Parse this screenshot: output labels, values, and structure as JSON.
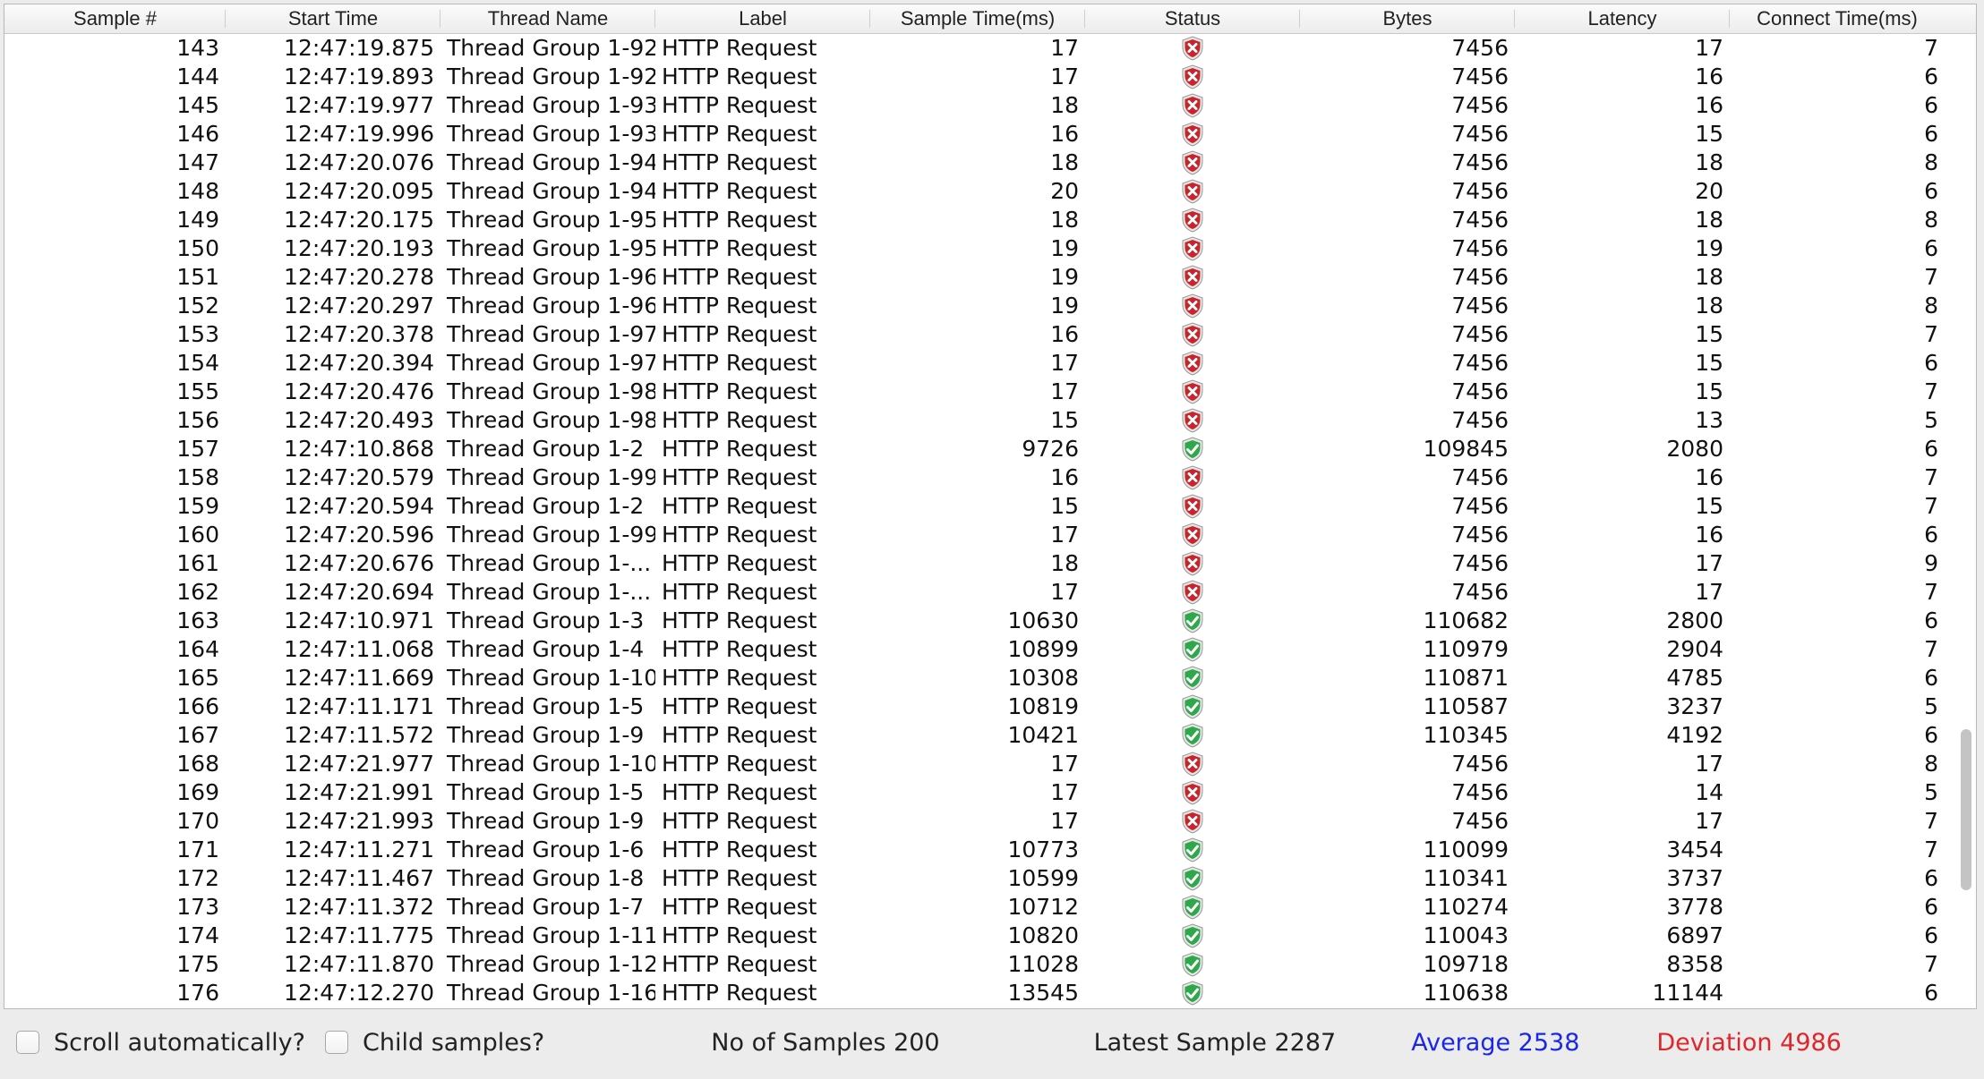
{
  "table": {
    "columns": [
      "Sample #",
      "Start Time",
      "Thread Name",
      "Label",
      "Sample Time(ms)",
      "Status",
      "Bytes",
      "Latency",
      "Connect Time(ms)"
    ],
    "rows": [
      {
        "sample": "143",
        "start": "12:47:19.875",
        "thread": "Thread Group 1-92",
        "label": "HTTP Request",
        "time": "17",
        "status": "error",
        "bytes": "7456",
        "latency": "17",
        "connect": "7"
      },
      {
        "sample": "144",
        "start": "12:47:19.893",
        "thread": "Thread Group 1-92",
        "label": "HTTP Request",
        "time": "17",
        "status": "error",
        "bytes": "7456",
        "latency": "16",
        "connect": "6"
      },
      {
        "sample": "145",
        "start": "12:47:19.977",
        "thread": "Thread Group 1-93",
        "label": "HTTP Request",
        "time": "18",
        "status": "error",
        "bytes": "7456",
        "latency": "16",
        "connect": "6"
      },
      {
        "sample": "146",
        "start": "12:47:19.996",
        "thread": "Thread Group 1-93",
        "label": "HTTP Request",
        "time": "16",
        "status": "error",
        "bytes": "7456",
        "latency": "15",
        "connect": "6"
      },
      {
        "sample": "147",
        "start": "12:47:20.076",
        "thread": "Thread Group 1-94",
        "label": "HTTP Request",
        "time": "18",
        "status": "error",
        "bytes": "7456",
        "latency": "18",
        "connect": "8"
      },
      {
        "sample": "148",
        "start": "12:47:20.095",
        "thread": "Thread Group 1-94",
        "label": "HTTP Request",
        "time": "20",
        "status": "error",
        "bytes": "7456",
        "latency": "20",
        "connect": "6"
      },
      {
        "sample": "149",
        "start": "12:47:20.175",
        "thread": "Thread Group 1-95",
        "label": "HTTP Request",
        "time": "18",
        "status": "error",
        "bytes": "7456",
        "latency": "18",
        "connect": "8"
      },
      {
        "sample": "150",
        "start": "12:47:20.193",
        "thread": "Thread Group 1-95",
        "label": "HTTP Request",
        "time": "19",
        "status": "error",
        "bytes": "7456",
        "latency": "19",
        "connect": "6"
      },
      {
        "sample": "151",
        "start": "12:47:20.278",
        "thread": "Thread Group 1-96",
        "label": "HTTP Request",
        "time": "19",
        "status": "error",
        "bytes": "7456",
        "latency": "18",
        "connect": "7"
      },
      {
        "sample": "152",
        "start": "12:47:20.297",
        "thread": "Thread Group 1-96",
        "label": "HTTP Request",
        "time": "19",
        "status": "error",
        "bytes": "7456",
        "latency": "18",
        "connect": "8"
      },
      {
        "sample": "153",
        "start": "12:47:20.378",
        "thread": "Thread Group 1-97",
        "label": "HTTP Request",
        "time": "16",
        "status": "error",
        "bytes": "7456",
        "latency": "15",
        "connect": "7"
      },
      {
        "sample": "154",
        "start": "12:47:20.394",
        "thread": "Thread Group 1-97",
        "label": "HTTP Request",
        "time": "17",
        "status": "error",
        "bytes": "7456",
        "latency": "15",
        "connect": "6"
      },
      {
        "sample": "155",
        "start": "12:47:20.476",
        "thread": "Thread Group 1-98",
        "label": "HTTP Request",
        "time": "17",
        "status": "error",
        "bytes": "7456",
        "latency": "15",
        "connect": "7"
      },
      {
        "sample": "156",
        "start": "12:47:20.493",
        "thread": "Thread Group 1-98",
        "label": "HTTP Request",
        "time": "15",
        "status": "error",
        "bytes": "7456",
        "latency": "13",
        "connect": "5"
      },
      {
        "sample": "157",
        "start": "12:47:10.868",
        "thread": "Thread Group 1-2",
        "label": "HTTP Request",
        "time": "9726",
        "status": "success",
        "bytes": "109845",
        "latency": "2080",
        "connect": "6"
      },
      {
        "sample": "158",
        "start": "12:47:20.579",
        "thread": "Thread Group 1-99",
        "label": "HTTP Request",
        "time": "16",
        "status": "error",
        "bytes": "7456",
        "latency": "16",
        "connect": "7"
      },
      {
        "sample": "159",
        "start": "12:47:20.594",
        "thread": "Thread Group 1-2",
        "label": "HTTP Request",
        "time": "15",
        "status": "error",
        "bytes": "7456",
        "latency": "15",
        "connect": "7"
      },
      {
        "sample": "160",
        "start": "12:47:20.596",
        "thread": "Thread Group 1-99",
        "label": "HTTP Request",
        "time": "17",
        "status": "error",
        "bytes": "7456",
        "latency": "16",
        "connect": "6"
      },
      {
        "sample": "161",
        "start": "12:47:20.676",
        "thread": "Thread Group 1-...",
        "label": "HTTP Request",
        "time": "18",
        "status": "error",
        "bytes": "7456",
        "latency": "17",
        "connect": "9"
      },
      {
        "sample": "162",
        "start": "12:47:20.694",
        "thread": "Thread Group 1-...",
        "label": "HTTP Request",
        "time": "17",
        "status": "error",
        "bytes": "7456",
        "latency": "17",
        "connect": "7"
      },
      {
        "sample": "163",
        "start": "12:47:10.971",
        "thread": "Thread Group 1-3",
        "label": "HTTP Request",
        "time": "10630",
        "status": "success",
        "bytes": "110682",
        "latency": "2800",
        "connect": "6"
      },
      {
        "sample": "164",
        "start": "12:47:11.068",
        "thread": "Thread Group 1-4",
        "label": "HTTP Request",
        "time": "10899",
        "status": "success",
        "bytes": "110979",
        "latency": "2904",
        "connect": "7"
      },
      {
        "sample": "165",
        "start": "12:47:11.669",
        "thread": "Thread Group 1-10",
        "label": "HTTP Request",
        "time": "10308",
        "status": "success",
        "bytes": "110871",
        "latency": "4785",
        "connect": "6"
      },
      {
        "sample": "166",
        "start": "12:47:11.171",
        "thread": "Thread Group 1-5",
        "label": "HTTP Request",
        "time": "10819",
        "status": "success",
        "bytes": "110587",
        "latency": "3237",
        "connect": "5"
      },
      {
        "sample": "167",
        "start": "12:47:11.572",
        "thread": "Thread Group 1-9",
        "label": "HTTP Request",
        "time": "10421",
        "status": "success",
        "bytes": "110345",
        "latency": "4192",
        "connect": "6"
      },
      {
        "sample": "168",
        "start": "12:47:21.977",
        "thread": "Thread Group 1-10",
        "label": "HTTP Request",
        "time": "17",
        "status": "error",
        "bytes": "7456",
        "latency": "17",
        "connect": "8"
      },
      {
        "sample": "169",
        "start": "12:47:21.991",
        "thread": "Thread Group 1-5",
        "label": "HTTP Request",
        "time": "17",
        "status": "error",
        "bytes": "7456",
        "latency": "14",
        "connect": "5"
      },
      {
        "sample": "170",
        "start": "12:47:21.993",
        "thread": "Thread Group 1-9",
        "label": "HTTP Request",
        "time": "17",
        "status": "error",
        "bytes": "7456",
        "latency": "17",
        "connect": "7"
      },
      {
        "sample": "171",
        "start": "12:47:11.271",
        "thread": "Thread Group 1-6",
        "label": "HTTP Request",
        "time": "10773",
        "status": "success",
        "bytes": "110099",
        "latency": "3454",
        "connect": "7"
      },
      {
        "sample": "172",
        "start": "12:47:11.467",
        "thread": "Thread Group 1-8",
        "label": "HTTP Request",
        "time": "10599",
        "status": "success",
        "bytes": "110341",
        "latency": "3737",
        "connect": "6"
      },
      {
        "sample": "173",
        "start": "12:47:11.372",
        "thread": "Thread Group 1-7",
        "label": "HTTP Request",
        "time": "10712",
        "status": "success",
        "bytes": "110274",
        "latency": "3778",
        "connect": "6"
      },
      {
        "sample": "174",
        "start": "12:47:11.775",
        "thread": "Thread Group 1-11",
        "label": "HTTP Request",
        "time": "10820",
        "status": "success",
        "bytes": "110043",
        "latency": "6897",
        "connect": "6"
      },
      {
        "sample": "175",
        "start": "12:47:11.870",
        "thread": "Thread Group 1-12",
        "label": "HTTP Request",
        "time": "11028",
        "status": "success",
        "bytes": "109718",
        "latency": "8358",
        "connect": "7"
      },
      {
        "sample": "176",
        "start": "12:47:12.270",
        "thread": "Thread Group 1-16",
        "label": "HTTP Request",
        "time": "13545",
        "status": "success",
        "bytes": "110638",
        "latency": "11144",
        "connect": "6"
      }
    ]
  },
  "status_icons": {
    "success": "green-shield-check-icon",
    "error": "red-shield-x-icon"
  },
  "colors": {
    "success": "#2fa84a",
    "error": "#c8242b",
    "average": "#1a27e6",
    "deviation": "#e0252b"
  },
  "footer": {
    "scroll_auto_label": "Scroll automatically?",
    "scroll_auto_checked": false,
    "child_samples_label": "Child samples?",
    "child_samples_checked": false,
    "samples_label": "No of Samples",
    "samples_value": "200",
    "latest_label": "Latest Sample",
    "latest_value": "2287",
    "average_label": "Average",
    "average_value": "2538",
    "deviation_label": "Deviation",
    "deviation_value": "4986"
  }
}
